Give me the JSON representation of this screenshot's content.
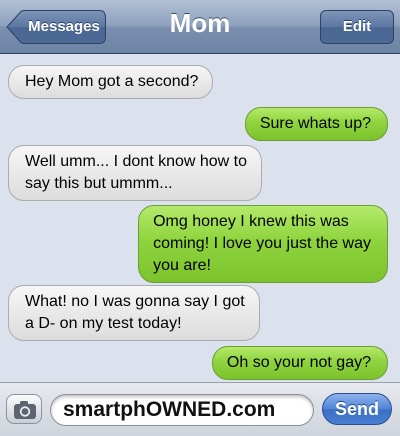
{
  "header": {
    "title": "Mom",
    "back_label": "Messages",
    "edit_label": "Edit"
  },
  "messages": [
    {
      "direction": "incoming",
      "lines": [
        "Hey Mom got a second?"
      ]
    },
    {
      "direction": "outgoing",
      "lines": [
        "Sure whats up?"
      ]
    },
    {
      "direction": "incoming",
      "lines": [
        "Well umm... I dont know how to",
        "say this but ummm..."
      ]
    },
    {
      "direction": "outgoing",
      "lines": [
        "Omg honey I knew this was",
        "coming! I love you just the way",
        "you are!"
      ]
    },
    {
      "direction": "incoming",
      "lines": [
        "What! no I was gonna say I got",
        "a D- on my test today!"
      ]
    },
    {
      "direction": "outgoing",
      "lines": [
        "Oh so your not gay?"
      ]
    }
  ],
  "input_bar": {
    "camera_icon": "camera-icon",
    "text_value": "smartphOWNED.com",
    "send_label": "Send"
  },
  "colors": {
    "incoming_bubble": "#e8e8e8",
    "outgoing_bubble": "#8fd43e",
    "chat_background": "#dbe2ed",
    "send_button": "#4f83d6"
  }
}
